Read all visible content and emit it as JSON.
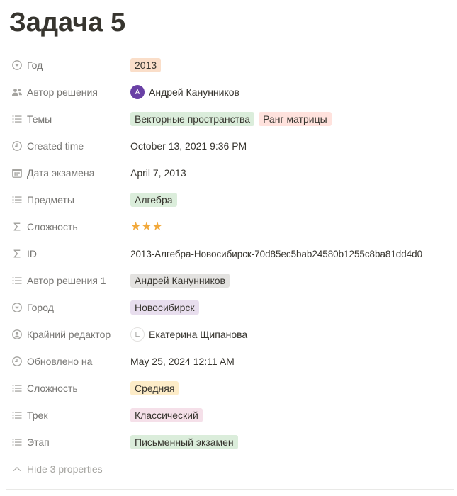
{
  "page": {
    "title": "Задача 5"
  },
  "colors": {
    "tag_orange": "#fadec9",
    "tag_green": "#dbeddb",
    "tag_red": "#ffe2dd",
    "tag_gray": "#e3e2e0",
    "tag_purple": "#e8deee",
    "tag_yellow": "#fdecc8",
    "tag_pink": "#f5e0e9",
    "star": "#f2a93b"
  },
  "properties": {
    "god": {
      "label": "Год",
      "icon": "select-icon",
      "value": "2013"
    },
    "author": {
      "label": "Автор решения",
      "icon": "people-icon",
      "avatar": "A",
      "value": "Андрей Канунников"
    },
    "topics": {
      "label": "Темы",
      "icon": "list-icon",
      "tags": [
        "Векторные пространства",
        "Ранг матрицы"
      ]
    },
    "created": {
      "label": "Created time",
      "icon": "clock-icon",
      "value": "October 13, 2021 9:36 PM"
    },
    "exam_date": {
      "label": "Дата экзамена",
      "icon": "calendar-icon",
      "value": "April 7, 2013"
    },
    "subjects": {
      "label": "Предметы",
      "icon": "list-icon",
      "value": "Алгебра"
    },
    "difficulty_formula": {
      "label": "Сложность",
      "icon": "sigma-icon",
      "value": "★★★"
    },
    "id": {
      "label": "ID",
      "icon": "sigma-icon",
      "value": "2013-Алгебра-Новосибирск-70d85ec5bab24580b1255c8ba81dd4d0"
    },
    "author1": {
      "label": "Автор решения 1",
      "icon": "list-icon",
      "value": "Андрей Канунников"
    },
    "city": {
      "label": "Город",
      "icon": "select-icon",
      "value": "Новосибирск"
    },
    "last_editor": {
      "label": "Крайний редактор",
      "icon": "person-icon",
      "avatar": "Е",
      "value": "Екатерина Щипанова"
    },
    "updated": {
      "label": "Обновлено на",
      "icon": "clock-icon",
      "value": "May 25, 2024 12:11 AM"
    },
    "difficulty": {
      "label": "Сложность",
      "icon": "list-icon",
      "value": "Средняя"
    },
    "track": {
      "label": "Трек",
      "icon": "list-icon",
      "value": "Классический"
    },
    "stage": {
      "label": "Этап",
      "icon": "list-icon",
      "value": "Письменный экзамен"
    }
  },
  "hide_properties_label": "Hide 3 properties"
}
